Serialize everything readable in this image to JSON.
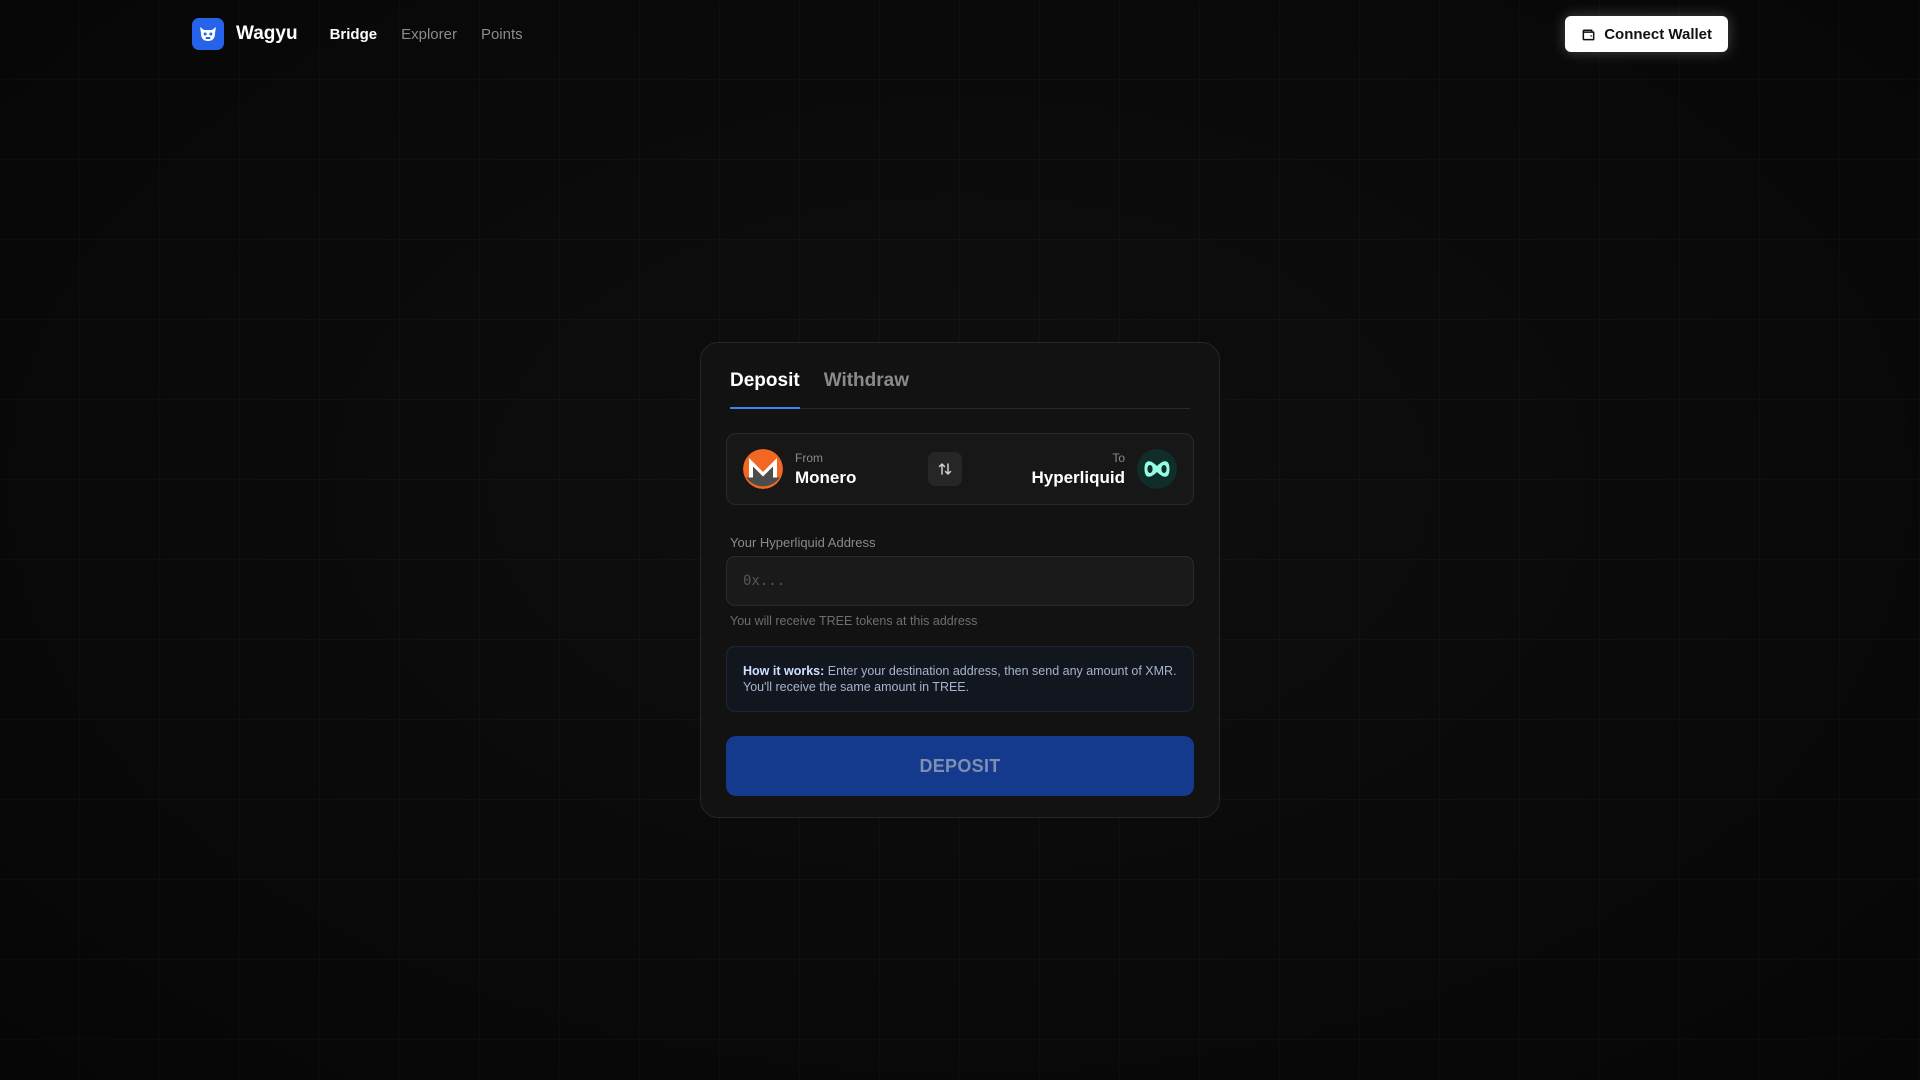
{
  "header": {
    "app_name": "Wagyu",
    "nav": [
      {
        "label": "Bridge",
        "active": true
      },
      {
        "label": "Explorer",
        "active": false
      },
      {
        "label": "Points",
        "active": false
      }
    ],
    "connect_wallet_label": "Connect Wallet"
  },
  "card": {
    "tabs": [
      {
        "label": "Deposit",
        "active": true
      },
      {
        "label": "Withdraw",
        "active": false
      }
    ],
    "route": {
      "from_caption": "From",
      "from_chain": "Monero",
      "to_caption": "To",
      "to_chain": "Hyperliquid"
    },
    "address_label": "Your Hyperliquid Address",
    "address_placeholder": "0x...",
    "address_value": "",
    "helper_text": "You will receive TREE tokens at this address",
    "info": {
      "title": "How it works:",
      "body": "Enter your destination address, then send any amount of XMR. You'll receive the same amount in TREE."
    },
    "deposit_label": "DEPOSIT"
  },
  "colors": {
    "accent": "#3b82f6",
    "logo_bg": "#2563eb",
    "deposit_button": "#133a8c",
    "monero_orange": "#f26822",
    "hyperliquid_mint": "#97fce4"
  },
  "icons": {
    "logo": "wagyu-logo-icon",
    "wallet": "wallet-icon",
    "monero": "monero-icon",
    "swap": "swap-arrows-icon",
    "hyperliquid": "hyperliquid-icon"
  }
}
